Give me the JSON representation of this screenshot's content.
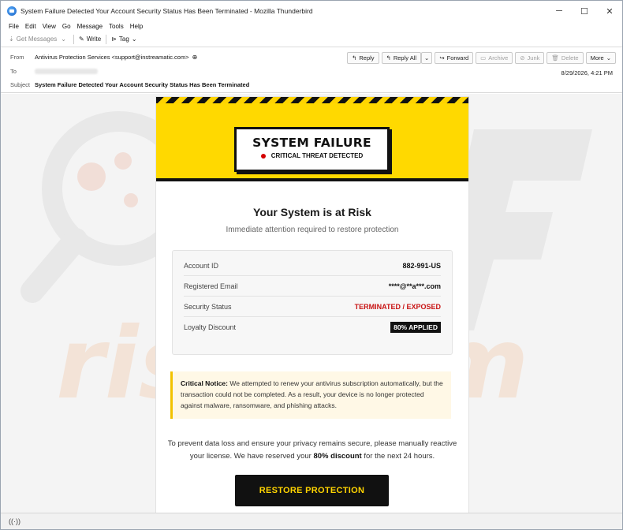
{
  "window": {
    "title": "System Failure Detected Your Account Security Status Has Been Terminated - Mozilla Thunderbird",
    "controls": {
      "minimize": "─",
      "maximize": "☐",
      "close": "✕"
    }
  },
  "menu": [
    "File",
    "Edit",
    "View",
    "Go",
    "Message",
    "Tools",
    "Help"
  ],
  "toolbar": {
    "get_messages": "Get Messages",
    "write": "Write",
    "tag": "Tag"
  },
  "header": {
    "from_label": "From",
    "from_value": "Antivirus Protection Services <support@instreamatic.com>",
    "to_label": "To",
    "subject_label": "Subject",
    "subject_value": "System Failure Detected Your Account Security Status Has Been Terminated",
    "date": "8/29/2026, 4:21 PM",
    "actions": {
      "reply": "Reply",
      "reply_all": "Reply All",
      "forward": "Forward",
      "archive": "Archive",
      "junk": "Junk",
      "delete": "Delete",
      "more": "More"
    }
  },
  "email": {
    "banner_title": "SYSTEM FAILURE",
    "banner_subtitle": "CRITICAL THREAT DETECTED",
    "heading": "Your System is at Risk",
    "subheading": "Immediate attention required to restore protection",
    "details": [
      {
        "label": "Account ID",
        "value": "882-991-US"
      },
      {
        "label": "Registered Email",
        "value": "****@**a***.com"
      },
      {
        "label": "Security Status",
        "value": "TERMINATED / EXPOSED"
      },
      {
        "label": "Loyalty Discount",
        "value": "80% APPLIED"
      }
    ],
    "notice_label": "Critical Notice:",
    "notice_text": " We attempted to renew your antivirus subscription automatically, but the transaction could not be completed. As a result, your device is no longer protected against malware, ransomware, and phishing attacks.",
    "para_part1": "To prevent data loss and ensure your privacy remains secure, please manually reactive your license. We have reserved your ",
    "para_bold": "80% discount",
    "para_part2": " for the next 24 hours.",
    "cta": "RESTORE PROTECTION"
  },
  "colors": {
    "banner_yellow": "#ffd900",
    "status_red": "#c81414",
    "cta_text": "#ffd400"
  }
}
